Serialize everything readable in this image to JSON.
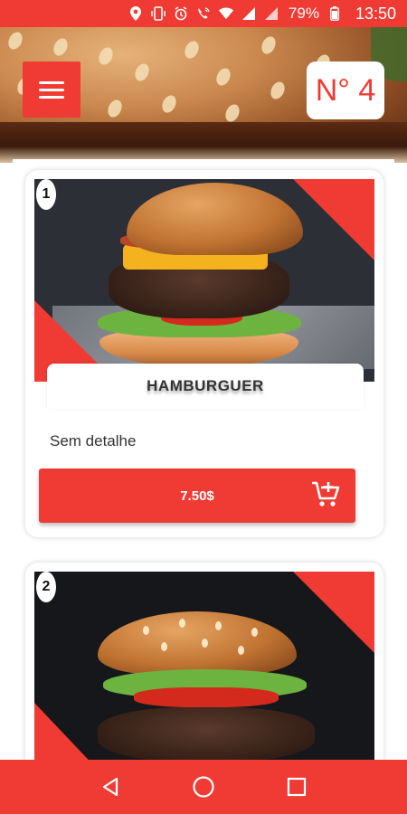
{
  "status_bar": {
    "battery": "79%",
    "time": "13:50"
  },
  "header": {
    "order_number": "N° 4"
  },
  "products": [
    {
      "index": "1",
      "name": "HAMBURGUER",
      "detail": "Sem detalhe",
      "price": "7.50$"
    },
    {
      "index": "2"
    }
  ],
  "colors": {
    "accent": "#ef3b33"
  },
  "icons": {
    "menu": "hamburger-menu-icon",
    "cart": "add-to-cart-icon",
    "back": "back-triangle-icon",
    "home": "home-circle-icon",
    "recents": "recents-square-icon"
  }
}
